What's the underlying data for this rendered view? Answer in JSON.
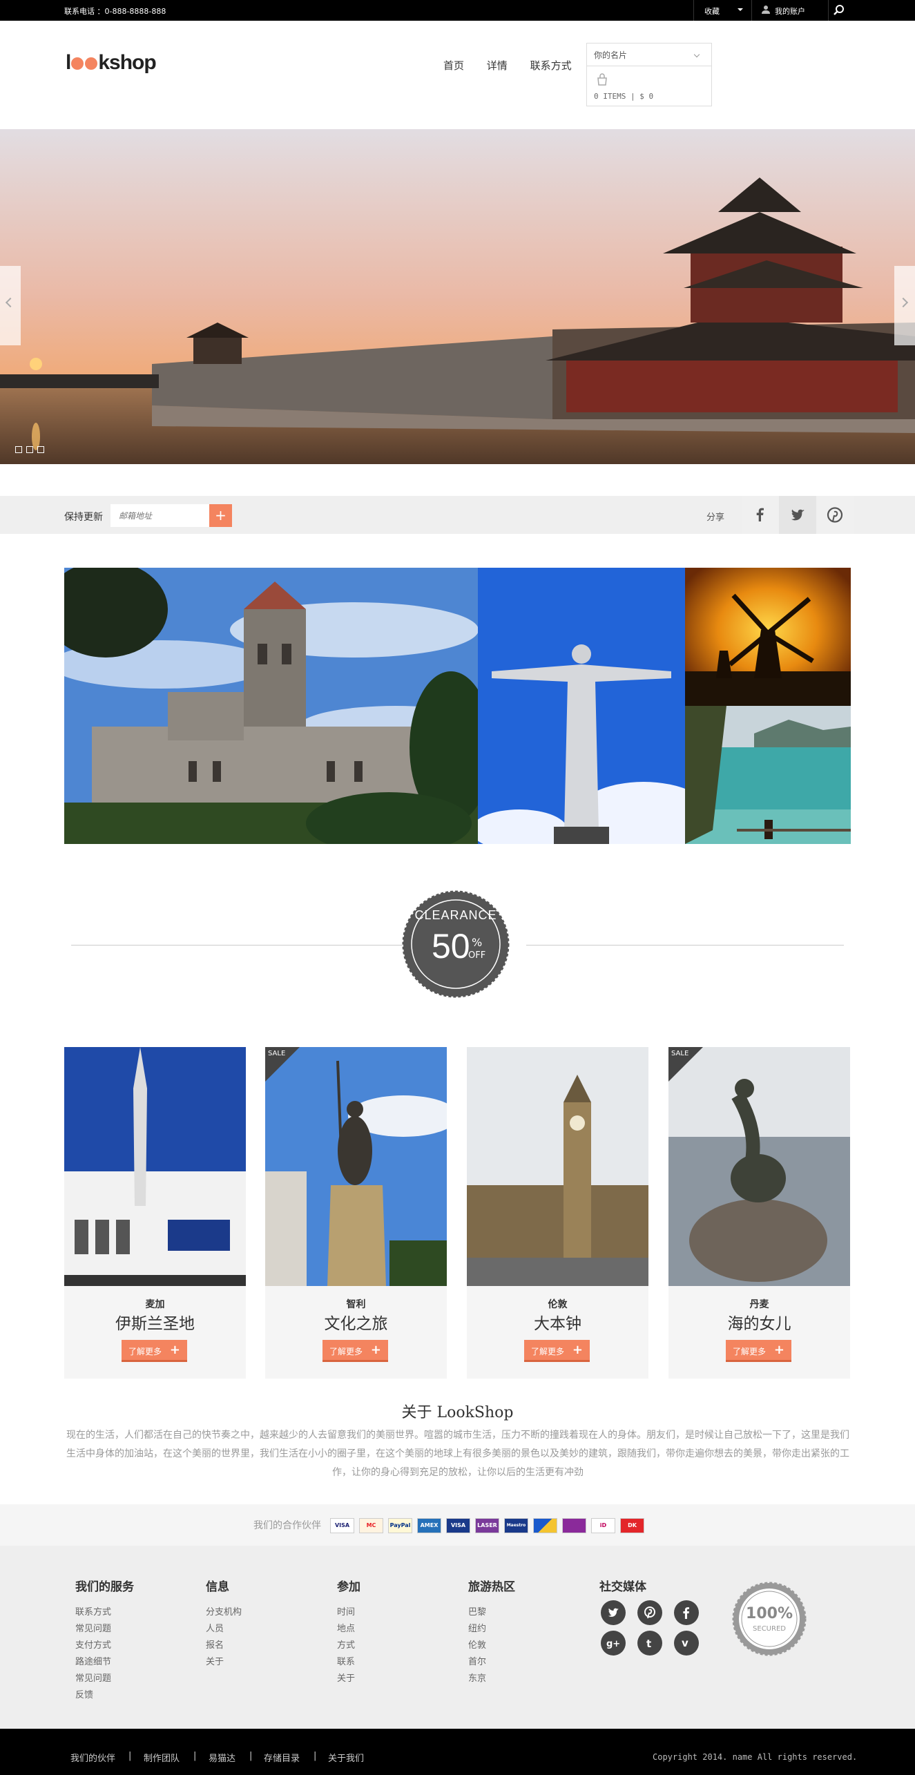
{
  "topbar": {
    "contact": "联系电话 ：0-888-8888-888",
    "favorites": "收藏",
    "account": "我的账户"
  },
  "header": {
    "logo_pre": "l",
    "logo_post": "kshop",
    "nav": [
      "首页",
      "详情",
      "联系方式"
    ]
  },
  "cart": {
    "title": "你的名片",
    "items": "0 ITEMS | $ 0"
  },
  "newsletter": {
    "label": "保持更新",
    "placeholder": "邮箱地址",
    "submit": "+",
    "share": "分享"
  },
  "clearance": {
    "line1": "CLEARANCE",
    "line2": "50",
    "pct": "%",
    "off": "OFF"
  },
  "products": [
    {
      "city": "麦加",
      "name": "伊斯兰圣地",
      "btn": "了解更多",
      "sale": ""
    },
    {
      "city": "智利",
      "name": "文化之旅",
      "btn": "了解更多",
      "sale": "SALE"
    },
    {
      "city": "伦敦",
      "name": "大本钟",
      "btn": "了解更多",
      "sale": ""
    },
    {
      "city": "丹麦",
      "name": "海的女儿",
      "btn": "了解更多",
      "sale": "SALE"
    }
  ],
  "about": {
    "title": "关于 LookShop",
    "text": "现在的生活，人们都活在自己的快节奏之中，越来越少的人去留意我们的美丽世界。喧嚣的城市生活，压力不断的撞践着现在人的身体。朋友们，是时候让自己放松一下了，这里是我们生活中身体的加油站，在这个美丽的世界里，我们生活在小小的圈子里，在这个美丽的地球上有很多美丽的景色以及美妙的建筑，跟随我们，带你走遍你想去的美景，带你走出紧张的工作，让你的身心得到充足的放松，让你以后的生活更有冲劲"
  },
  "partners": {
    "label": "我们的合作伙伴",
    "cards": [
      "VISA",
      "MC",
      "PayPal",
      "AMEX",
      "VISA",
      "LASER",
      "Maestro",
      "",
      "",
      "iD",
      "DK"
    ]
  },
  "footer": {
    "cols": [
      {
        "title": "我们的服务",
        "links": [
          "联系方式",
          "常见问题",
          "支付方式",
          "路途细节",
          "常见问题",
          "反馈"
        ]
      },
      {
        "title": "信息",
        "links": [
          "分支机构",
          "人员",
          "报名",
          "关于"
        ]
      },
      {
        "title": "参加",
        "links": [
          "时间",
          "地点",
          "方式",
          "联系",
          "关于"
        ]
      },
      {
        "title": "旅游热区",
        "links": [
          "巴黎",
          "纽约",
          "伦敦",
          "首尔",
          "东京"
        ]
      }
    ],
    "social_title": "社交媒体",
    "badge_big": "100%",
    "badge_small": "SECURED"
  },
  "bottom": {
    "links": [
      "我们的伙伴",
      "制作团队",
      "易猫达",
      "存储目录",
      "关于我们"
    ],
    "copyright": "Copyright 2014. name All rights reserved."
  },
  "colors": {
    "accent": "#f4845f",
    "dark": "#444444"
  }
}
